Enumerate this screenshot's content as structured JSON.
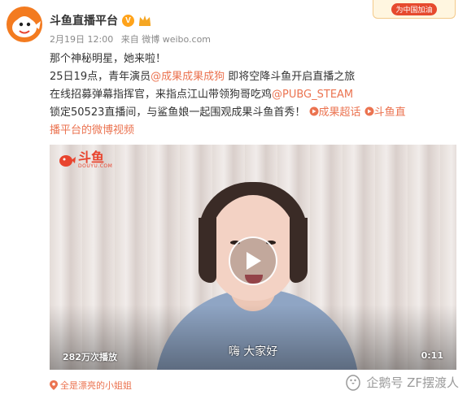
{
  "account": {
    "name": "斗鱼直播平台",
    "verified_badge": "V",
    "avatar_icon": "douyu-fish-icon",
    "member_icon": "crown-icon"
  },
  "post_meta": {
    "date": "2月19日 12:00",
    "source": "来自 微博 weibo.com"
  },
  "banner": {
    "label": "为中国加油"
  },
  "content": {
    "line1": "那个神秘明星，她来啦！",
    "line2_prefix": "25日19点，青年演员",
    "line2_mention": "@成果成果成狗",
    "line2_suffix": " 即将空降斗鱼开启直播之旅",
    "line3_prefix": "在线招募弹幕指挥官，来指点江山带领狗哥吃鸡",
    "line3_mention": "@PUBG_STEAM",
    "line4_prefix": "锁定50523直播间，与鲨鱼娘一起围观成果斗鱼首秀！",
    "line4_topic1": "成果超话",
    "line4_topic2": "斗鱼直",
    "line5_topic2_cont": "播平台的微博视频"
  },
  "video": {
    "logo_text": "斗鱼",
    "logo_sub": "DOUYU.COM",
    "subtitle": "嗨 大家好",
    "play_count": "282万次播放",
    "duration": "0:11",
    "play_icon": "play-icon"
  },
  "location": {
    "label": "全是漂亮的小姐姐",
    "icon": "location-pin-icon"
  },
  "watermark": {
    "text": "企鹅号 ZF摆渡人"
  },
  "colors": {
    "link": "#eb7350",
    "avatar_bg": "#f37b20",
    "badge": "#ffa31a",
    "logo_red": "#e8442e"
  }
}
